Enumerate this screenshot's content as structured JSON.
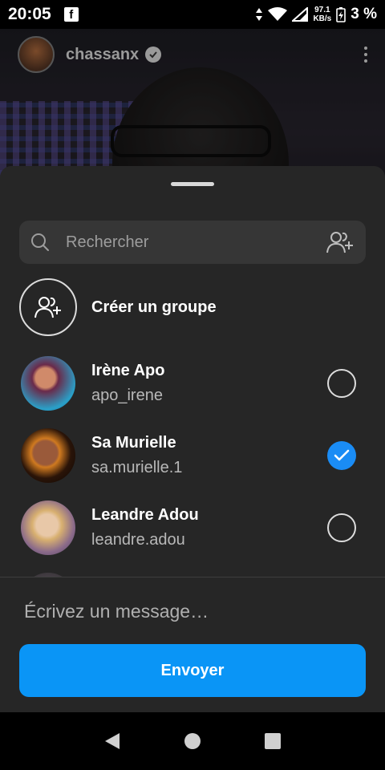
{
  "status_bar": {
    "time": "20:05",
    "speed_value": "97.1",
    "speed_unit": "KB/s",
    "battery": "3 %"
  },
  "header": {
    "username": "chassanx"
  },
  "search": {
    "placeholder": "Rechercher"
  },
  "create_group": {
    "label": "Créer un groupe"
  },
  "contacts": [
    {
      "name": "Irène Apo",
      "username": "apo_irene",
      "selected": false
    },
    {
      "name": "Sa Murielle",
      "username": "sa.murielle.1",
      "selected": true
    },
    {
      "name": "Leandre Adou",
      "username": "leandre.adou",
      "selected": false
    }
  ],
  "message": {
    "placeholder": "Écrivez un message…"
  },
  "send_button": {
    "label": "Envoyer"
  },
  "colors": {
    "accent": "#0a95f6",
    "sheet_bg": "#262626",
    "search_bg": "#363636"
  }
}
